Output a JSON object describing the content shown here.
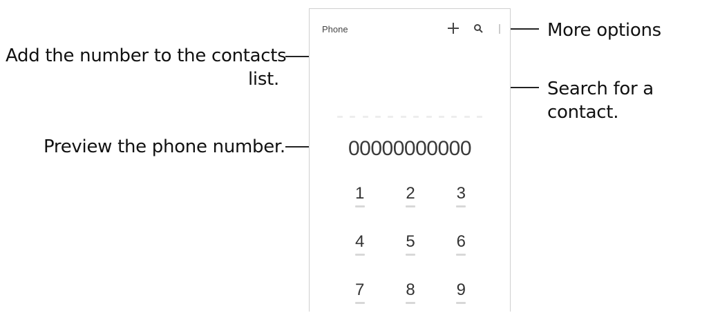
{
  "app": {
    "title": "Phone"
  },
  "toolbar": {
    "add_icon": "plus-icon",
    "search_icon": "search-icon",
    "more_icon": "more-vert-icon"
  },
  "dialer": {
    "number": "00000000000"
  },
  "keypad": {
    "keys": [
      {
        "digit": "1"
      },
      {
        "digit": "2"
      },
      {
        "digit": "3"
      },
      {
        "digit": "4"
      },
      {
        "digit": "5"
      },
      {
        "digit": "6"
      },
      {
        "digit": "7"
      },
      {
        "digit": "8"
      },
      {
        "digit": "9"
      }
    ]
  },
  "callouts": {
    "more_options": "More options",
    "add_number_line1": "Add the number to the contacts",
    "add_number_line2": "list.",
    "search_contact": "Search for a contact.",
    "preview_number": "Preview the phone number."
  }
}
